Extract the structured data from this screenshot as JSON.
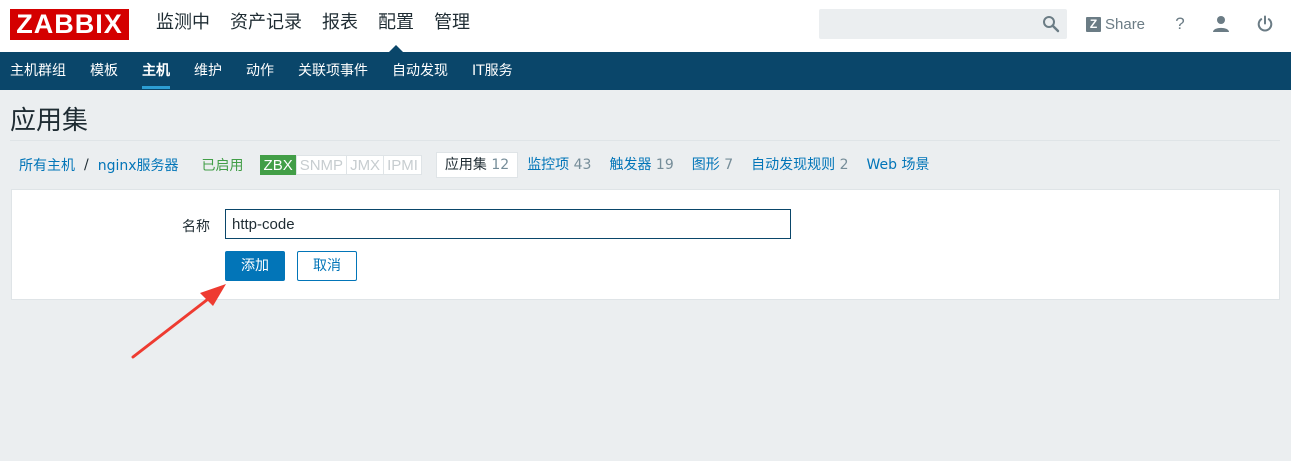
{
  "brand": {
    "logo": "ZABBIX"
  },
  "main_menu": [
    {
      "label": "监测中"
    },
    {
      "label": "资产记录"
    },
    {
      "label": "报表"
    },
    {
      "label": "配置"
    },
    {
      "label": "管理"
    }
  ],
  "header_tools": {
    "search_value": "",
    "share_label": "Share",
    "help_label": "?"
  },
  "sub_menu": [
    {
      "label": "主机群组"
    },
    {
      "label": "模板"
    },
    {
      "label": "主机"
    },
    {
      "label": "维护"
    },
    {
      "label": "动作"
    },
    {
      "label": "关联项事件"
    },
    {
      "label": "自动发现"
    },
    {
      "label": "IT服务"
    }
  ],
  "page": {
    "title": "应用集"
  },
  "breadcrumb": {
    "all_hosts": "所有主机",
    "separator": "/",
    "host": "nginx服务器",
    "status": "已启用",
    "availability": [
      "ZBX",
      "SNMP",
      "JMX",
      "IPMI"
    ],
    "tabs": [
      {
        "label": "应用集",
        "count": "12"
      },
      {
        "label": "监控项",
        "count": "43"
      },
      {
        "label": "触发器",
        "count": "19"
      },
      {
        "label": "图形",
        "count": "7"
      },
      {
        "label": "自动发现规则",
        "count": "2"
      },
      {
        "label": "Web 场景",
        "count": ""
      }
    ]
  },
  "form": {
    "name_label": "名称",
    "name_value": "http-code",
    "add_label": "添加",
    "cancel_label": "取消"
  },
  "colors": {
    "brand": "#d40000",
    "nav": "#0a466a",
    "link": "#0275b8",
    "enabled": "#429e47",
    "annotation_arrow": "#ee3b31"
  }
}
